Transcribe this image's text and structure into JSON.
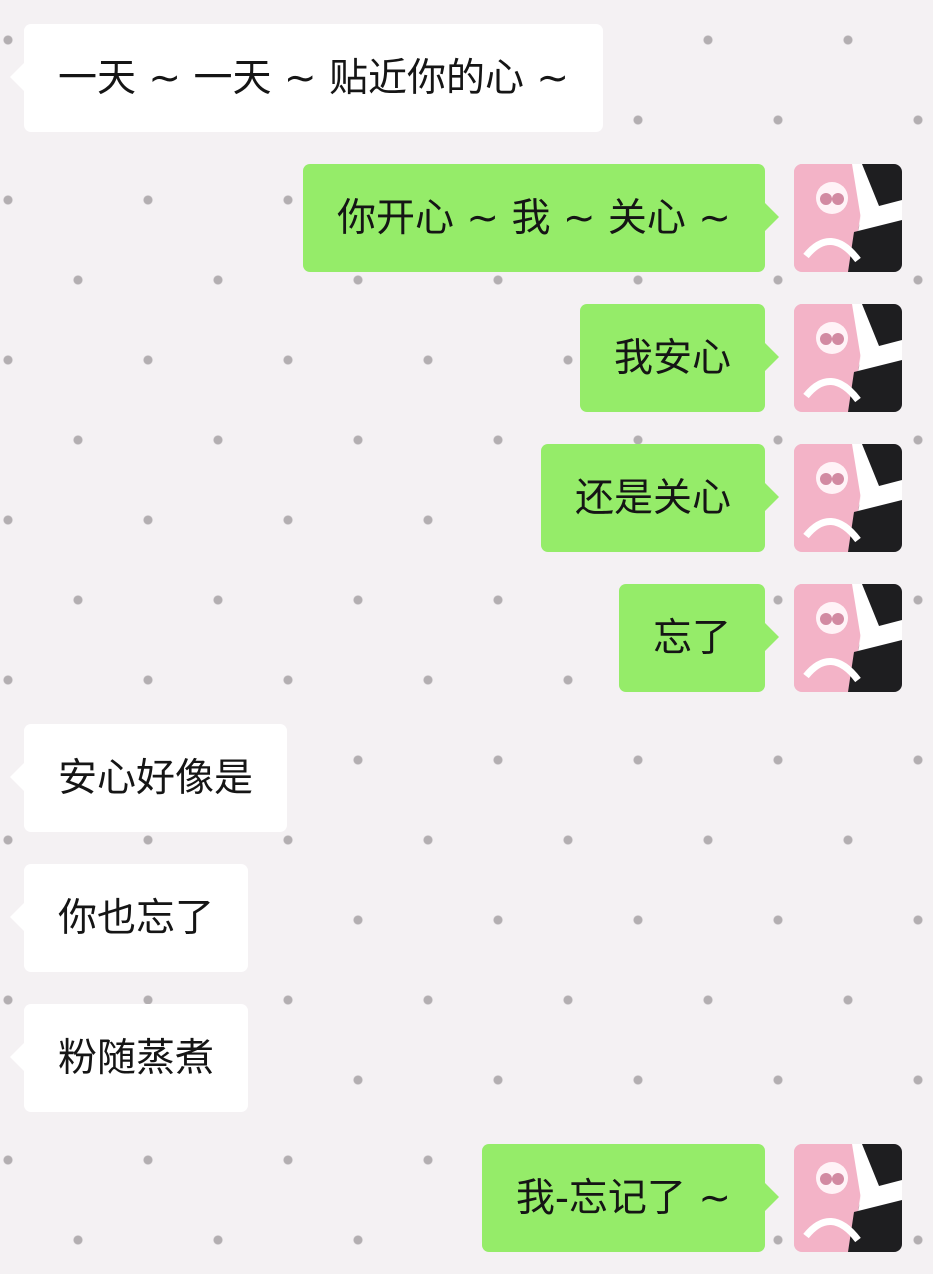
{
  "chat": {
    "messages": [
      {
        "side": "left",
        "text": "一天 ~ 一天 ~ 贴近你的心 ~"
      },
      {
        "side": "right",
        "text": "你开心 ~ 我 ~ 关心 ~"
      },
      {
        "side": "right",
        "text": "我安心"
      },
      {
        "side": "right",
        "text": "还是关心"
      },
      {
        "side": "right",
        "text": "忘了"
      },
      {
        "side": "left",
        "text": "安心好像是"
      },
      {
        "side": "left",
        "text": "你也忘了"
      },
      {
        "side": "left",
        "text": "粉随蒸煮"
      },
      {
        "side": "right",
        "text": "我-忘记了 ~"
      }
    ]
  },
  "colors": {
    "background": "#f4f1f3",
    "incoming_bubble": "#ffffff",
    "outgoing_bubble": "#95ec69",
    "text": "#151515",
    "pattern_heart": "#a8a3a6"
  },
  "icons": {
    "background_pattern": "heart-pattern-icon",
    "user_avatar": "anime-avatar-icon"
  }
}
